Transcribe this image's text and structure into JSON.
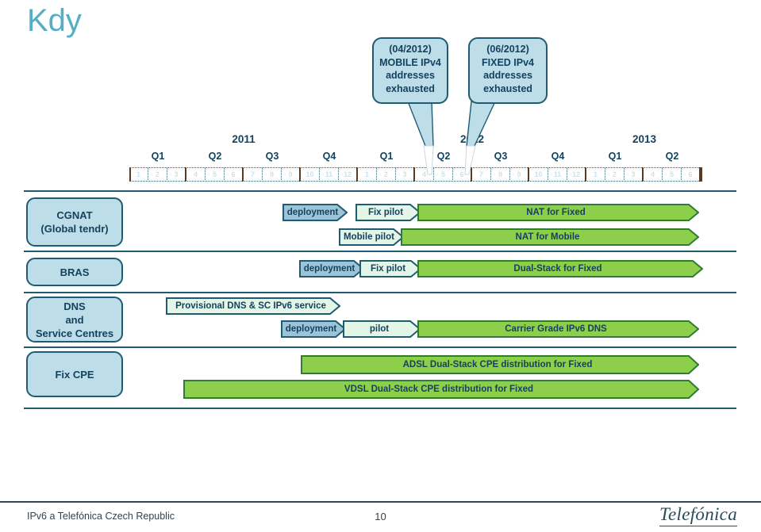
{
  "slide": {
    "title": "Kdy",
    "title_color": "#55AEC4"
  },
  "callouts": [
    {
      "id": "mobile-exhaust",
      "lines": [
        "(04/2012)",
        "MOBILE IPv4",
        "addresses",
        "exhausted"
      ],
      "fill": "#BDDDE8",
      "border": "#1F5C72"
    },
    {
      "id": "fixed-exhaust",
      "lines": [
        "(06/2012)",
        "FIXED IPv4",
        "addresses",
        "exhausted"
      ],
      "fill": "#BDDDE8",
      "border": "#1F5C72"
    }
  ],
  "timeline": {
    "years": [
      {
        "label": "2011",
        "quarters": 4
      },
      {
        "label": "2012",
        "quarters": 4
      },
      {
        "label": "2013",
        "quarters": 2
      }
    ],
    "quarters": [
      "Q1",
      "Q2",
      "Q3",
      "Q4",
      "Q1",
      "Q2",
      "Q3",
      "Q4",
      "Q1",
      "Q2"
    ],
    "months": [
      "1",
      "2",
      "3",
      "4",
      "5",
      "6",
      "7",
      "8",
      "9",
      "10",
      "11",
      "12",
      "1",
      "2",
      "3",
      "4",
      "5",
      "6",
      "7",
      "8",
      "9",
      "10",
      "11",
      "12",
      "1",
      "2",
      "3",
      "4",
      "5",
      "6"
    ],
    "month_label_color": "#CFE2E8",
    "tick_color": "#5B3A20"
  },
  "rows": [
    {
      "id": "cgnat",
      "label_lines": [
        "CGNAT",
        "(Global tendr)"
      ],
      "bars": [
        {
          "text": "deployment",
          "style": "blue"
        },
        {
          "text": "Fix pilot",
          "style": "pale"
        },
        {
          "text": "NAT for Fixed",
          "style": "green"
        },
        {
          "text": "Mobile pilot",
          "style": "pale"
        },
        {
          "text": "NAT for Mobile",
          "style": "green"
        }
      ]
    },
    {
      "id": "bras",
      "label_lines": [
        "BRAS"
      ],
      "bars": [
        {
          "text": "deployment",
          "style": "blue"
        },
        {
          "text": "Fix pilot",
          "style": "pale"
        },
        {
          "text": "Dual-Stack for Fixed",
          "style": "green"
        }
      ]
    },
    {
      "id": "dns",
      "label_lines": [
        "DNS",
        "and",
        "Service Centres"
      ],
      "bars": [
        {
          "text": "Provisional DNS & SC IPv6 service",
          "style": "pale"
        },
        {
          "text": "deployment",
          "style": "blue"
        },
        {
          "text": "pilot",
          "style": "pale"
        },
        {
          "text": "Carrier Grade IPv6 DNS",
          "style": "green"
        }
      ]
    },
    {
      "id": "fixcpe",
      "label_lines": [
        "Fix CPE"
      ],
      "bars": [
        {
          "text": "ADSL Dual-Stack CPE distribution for Fixed",
          "style": "green"
        },
        {
          "text": "VDSL Dual-Stack CPE distribution for Fixed",
          "style": "green"
        }
      ]
    }
  ],
  "colors": {
    "green_fill": "#8DCE4B",
    "green_border": "#2E7D32",
    "blue_fill": "#9CC4D8",
    "pale_fill": "#E3F5E7",
    "box_fill": "#BDDDE8",
    "box_border": "#1F5C72",
    "text_dark": "#14425E"
  },
  "footer": {
    "left": "IPv6 a Telefónica Czech Republic",
    "page": "10",
    "logo": "Telefónica"
  }
}
